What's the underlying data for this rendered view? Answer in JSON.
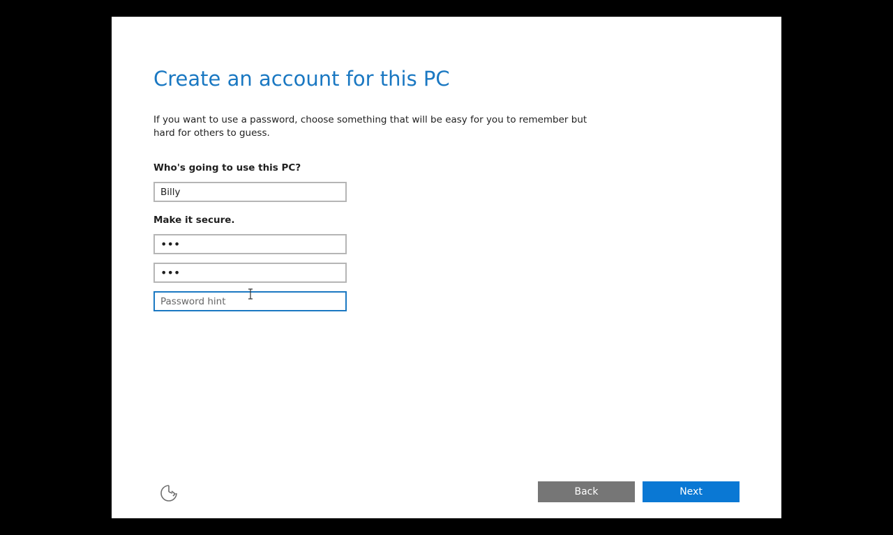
{
  "colors": {
    "accent": "#1a78c2",
    "next_button": "#0a78d4",
    "back_button": "#767676",
    "focus_border": "#1a78c2",
    "field_border": "#b5b5b5"
  },
  "page": {
    "title": "Create an account for this PC",
    "intro": "If you want to use a password, choose something that will be easy for you to remember but hard for others to guess."
  },
  "form": {
    "user_label": "Who's going to use this PC?",
    "user_value": "Billy",
    "secure_label": "Make it secure.",
    "password_value": "•••",
    "confirm_value": "•••",
    "hint_value": "",
    "hint_placeholder": "Password hint"
  },
  "footer": {
    "accessibility_icon": "ease-of-access-icon",
    "back_label": "Back",
    "next_label": "Next"
  }
}
